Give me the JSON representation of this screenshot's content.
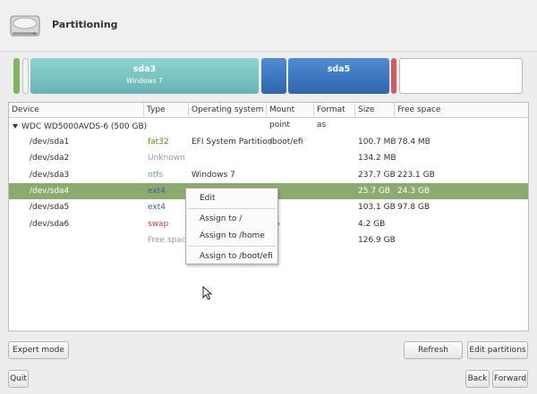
{
  "header": {
    "title": "Partitioning",
    "icon": "disk-drive-icon"
  },
  "partition_bar": [
    {
      "label": "",
      "sub": "",
      "color": "#7fb55f"
    },
    {
      "label": "",
      "sub": "",
      "color": "#f2f2f2"
    },
    {
      "label": "sda3",
      "sub": "Windows 7",
      "color": "#79c8c6"
    },
    {
      "label": "",
      "sub": "",
      "color": "#3d79c2"
    },
    {
      "label": "sda5",
      "sub": "",
      "color": "#3d79c2"
    },
    {
      "label": "",
      "sub": "",
      "color": "#d9585a"
    },
    {
      "label": "",
      "sub": "",
      "color": "#ffffff"
    }
  ],
  "columns": [
    "Device",
    "Type",
    "Operating system",
    "Mount point",
    "Format as",
    "Size",
    "Free space"
  ],
  "disk": {
    "label": "WDC WD5000AVDS-6 (500 GB)"
  },
  "rows": [
    {
      "device": "/dev/sda1",
      "type": "fat32",
      "type_color": "#4e9a06",
      "os": "EFI System Partition",
      "mount": "/boot/efi",
      "format": "",
      "size": "100.7 MB",
      "free": "78.4 MB"
    },
    {
      "device": "/dev/sda2",
      "type": "Unknown",
      "type_color": "#9a9a9a",
      "os": "",
      "mount": "",
      "format": "",
      "size": "134.2 MB",
      "free": ""
    },
    {
      "device": "/dev/sda3",
      "type": "ntfs",
      "type_color": "#5fa8a6",
      "os": "Windows 7",
      "mount": "",
      "format": "",
      "size": "237.7 GB",
      "free": "223.1 GB"
    },
    {
      "device": "/dev/sda4",
      "type": "ext4",
      "type_color": "#3465a4",
      "os": "",
      "mount": "",
      "format": "",
      "size": "25.7 GB",
      "free": "24.3 GB"
    },
    {
      "device": "/dev/sda5",
      "type": "ext4",
      "type_color": "#3465a4",
      "os": "",
      "mount": "",
      "format": "",
      "size": "103.1 GB",
      "free": "97.8 GB"
    },
    {
      "device": "/dev/sda6",
      "type": "swap",
      "type_color": "#cc3b3b",
      "os": "",
      "mount": "ap",
      "format": "",
      "size": "4.2 GB",
      "free": ""
    },
    {
      "device": "",
      "type": "Free space",
      "type_color": "#9a9a9a",
      "os": "",
      "mount": "",
      "format": "",
      "size": "126.9 GB",
      "free": ""
    }
  ],
  "selected_row": 3,
  "context_menu": {
    "edit": "Edit",
    "assign_root": "Assign to /",
    "assign_home": "Assign to /home",
    "assign_boot_efi": "Assign to /boot/efi"
  },
  "buttons": {
    "expert_mode": "Expert mode",
    "refresh": "Refresh",
    "edit_partitions": "Edit partitions",
    "quit": "Quit",
    "back": "Back",
    "forward": "Forward"
  }
}
